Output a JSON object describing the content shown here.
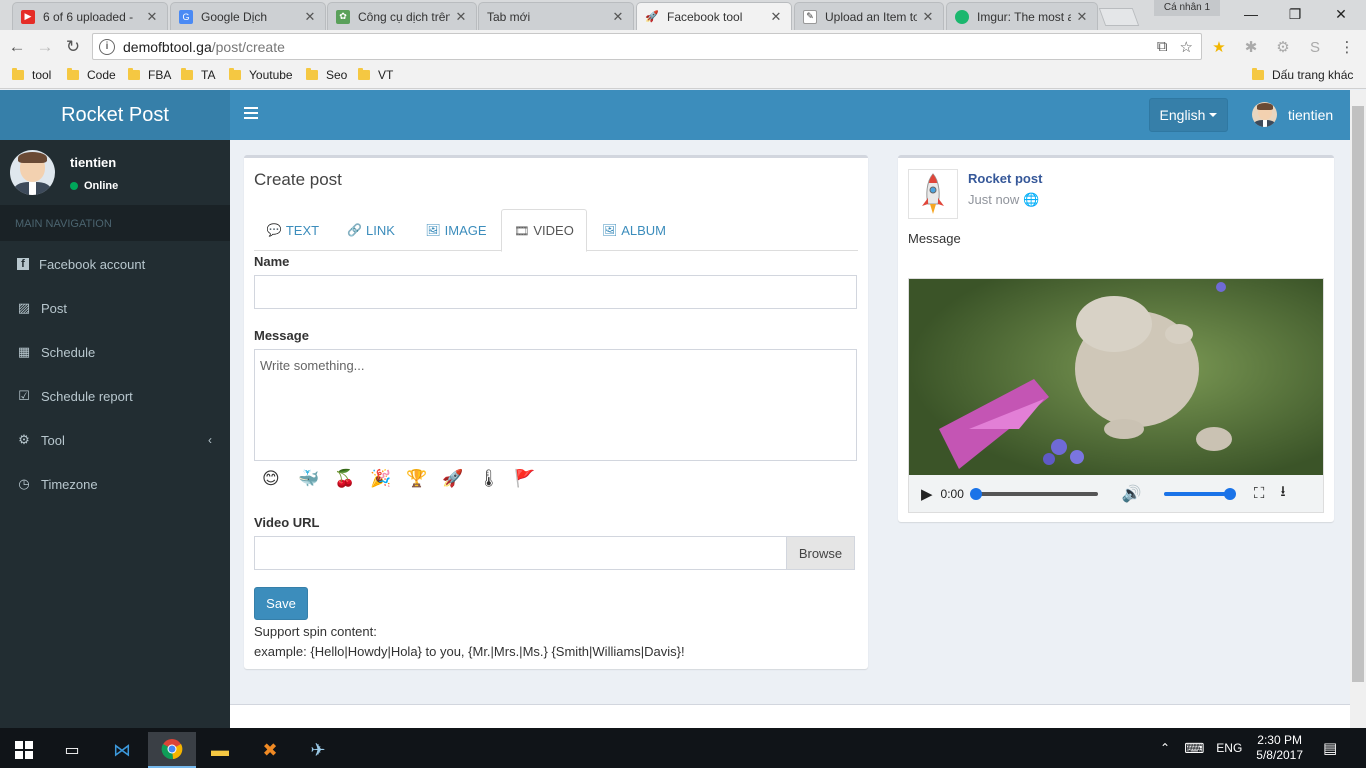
{
  "browser": {
    "tabs": [
      {
        "label": "6 of 6 uploaded -",
        "fav": "#e52d27",
        "glyph": "▶"
      },
      {
        "label": "Google Dịch",
        "fav": "#4a8af4",
        "glyph": "G"
      },
      {
        "label": "Công cụ dịch trên",
        "fav": "#5aa05a",
        "glyph": "✿"
      },
      {
        "label": "Tab mới",
        "fav": "",
        "glyph": ""
      },
      {
        "label": "Facebook tool",
        "fav": "#ffffff",
        "glyph": "🚀"
      },
      {
        "label": "Upload an Item to",
        "fav": "#ffffff",
        "glyph": "✎"
      },
      {
        "label": "Imgur: The most a",
        "fav": "#1bb76e",
        "glyph": "●"
      }
    ],
    "profile": "Cá nhân 1",
    "url_host": "demofbtool.ga",
    "url_path": "/post/create",
    "bookmarks": [
      "tool",
      "Code",
      "FBA",
      "TA",
      "Youtube",
      "Seo",
      "VT"
    ],
    "other_bookmarks": "Dấu trang khác"
  },
  "app": {
    "brand": "Rocket Post",
    "language": "English",
    "username": "tientien",
    "status": "Online",
    "nav_header": "MAIN NAVIGATION",
    "nav": [
      {
        "label": "Facebook account",
        "icon": "facebook-icon",
        "glyph": "f"
      },
      {
        "label": "Post",
        "icon": "image-icon",
        "glyph": "▨"
      },
      {
        "label": "Schedule",
        "icon": "calendar-icon",
        "glyph": "▦"
      },
      {
        "label": "Schedule report",
        "icon": "calendar-check-icon",
        "glyph": "☑"
      },
      {
        "label": "Tool",
        "icon": "cogs-icon",
        "glyph": "⚙"
      },
      {
        "label": "Timezone",
        "icon": "clock-icon",
        "glyph": "◷"
      }
    ]
  },
  "form": {
    "title": "Create post",
    "tabs": [
      {
        "label": "TEXT",
        "glyph": "💬"
      },
      {
        "label": "LINK",
        "glyph": "🔗"
      },
      {
        "label": "IMAGE",
        "glyph": "🖼"
      },
      {
        "label": "VIDEO",
        "glyph": "🎞"
      },
      {
        "label": "ALBUM",
        "glyph": "🖼"
      }
    ],
    "active_tab": "VIDEO",
    "name_label": "Name",
    "name_value": "",
    "message_label": "Message",
    "message_placeholder": "Write something...",
    "emojis": [
      "😊",
      "🐳",
      "🍒",
      "🎉",
      "🏆",
      "🚀",
      "🌡",
      "🚩"
    ],
    "video_url_label": "Video URL",
    "browse_label": "Browse",
    "save_label": "Save",
    "spin_note": "Support spin content:",
    "spin_example": "example: {Hello|Howdy|Hola} to you, {Mr.|Mrs.|Ms.} {Smith|Williams|Davis}!"
  },
  "preview": {
    "page_name": "Rocket post",
    "time": "Just now",
    "message": "Message",
    "video_time": "0:00",
    "volume_fraction": 1.0,
    "progress_fraction": 0.0
  },
  "taskbar": {
    "lang": "ENG",
    "time": "2:30 PM",
    "date": "5/8/2017"
  }
}
